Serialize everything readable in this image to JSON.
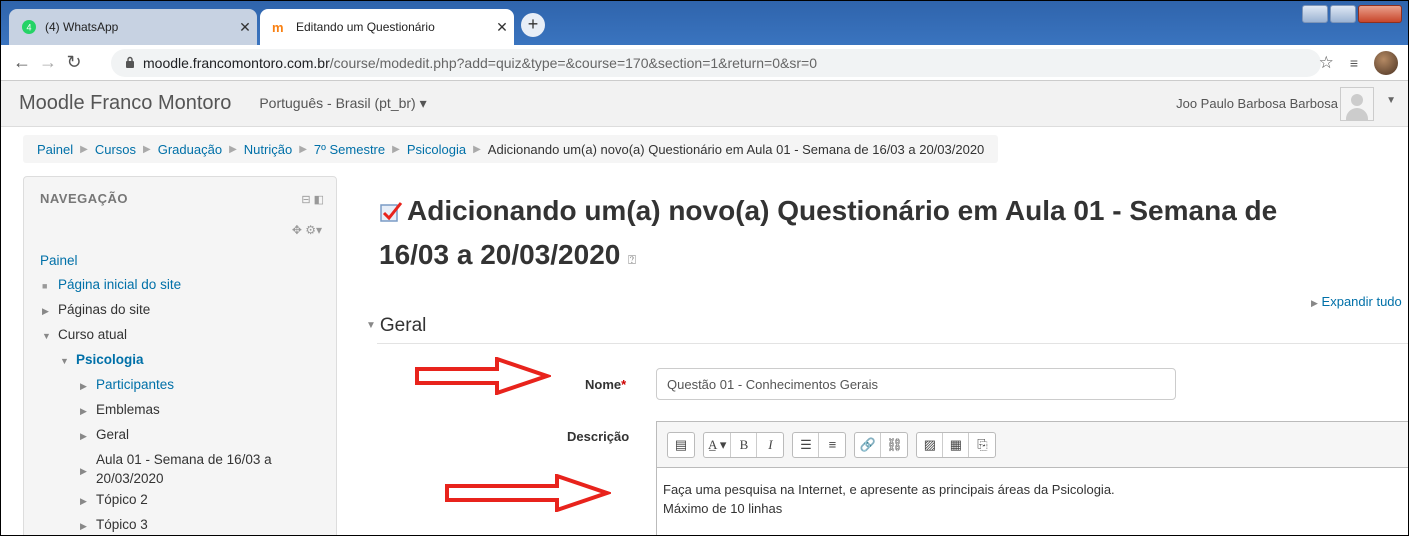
{
  "browser": {
    "tabs": [
      {
        "title": "(4) WhatsApp",
        "icon": "whatsapp-icon"
      },
      {
        "title": "Editando um Questionário",
        "icon": "moodle-favicon"
      }
    ],
    "url_host": "moodle.francomontoro.com.br",
    "url_path": "/course/modedit.php?add=quiz&type=&course=170&section=1&return=0&sr=0"
  },
  "navbar": {
    "brand": "Moodle Franco Montoro",
    "language": "Português - Brasil (pt_br) ▾",
    "user": "Joo Paulo Barbosa Barbosa"
  },
  "breadcrumb": [
    "Painel",
    "Cursos",
    "Graduação",
    "Nutrição",
    "7º Semestre",
    "Psicologia",
    "Adicionando um(a) novo(a) Questionário em Aula 01 - Semana de 16/03 a 20/03/2020"
  ],
  "sidebar": {
    "title": "NAVEGAÇÃO",
    "root": "Painel",
    "items": [
      "Página inicial do site",
      "Páginas do site",
      "Curso atual"
    ],
    "course": "Psicologia",
    "course_items": [
      "Participantes",
      "Emblemas",
      "Geral",
      "Aula 01 - Semana de 16/03 a",
      "20/03/2020",
      "Tópico 2",
      "Tópico 3"
    ]
  },
  "main": {
    "title_line1": "Adicionando um(a) novo(a) Questionário em Aula 01 - Semana de",
    "title_line2": "16/03 a 20/03/2020",
    "expand_all": "Expandir tudo",
    "section": "Geral",
    "name_label": "Nome",
    "name_value": "Questão 01 - Conhecimentos Gerais",
    "desc_label": "Descrição",
    "desc_line1": "Faça uma pesquisa na Internet, e apresente as principais áreas da Psicologia.",
    "desc_line2": "Máximo de 10 linhas"
  },
  "colors": {
    "link": "#0070a8",
    "arrow": "#e8231c",
    "required": "#cc0000"
  }
}
